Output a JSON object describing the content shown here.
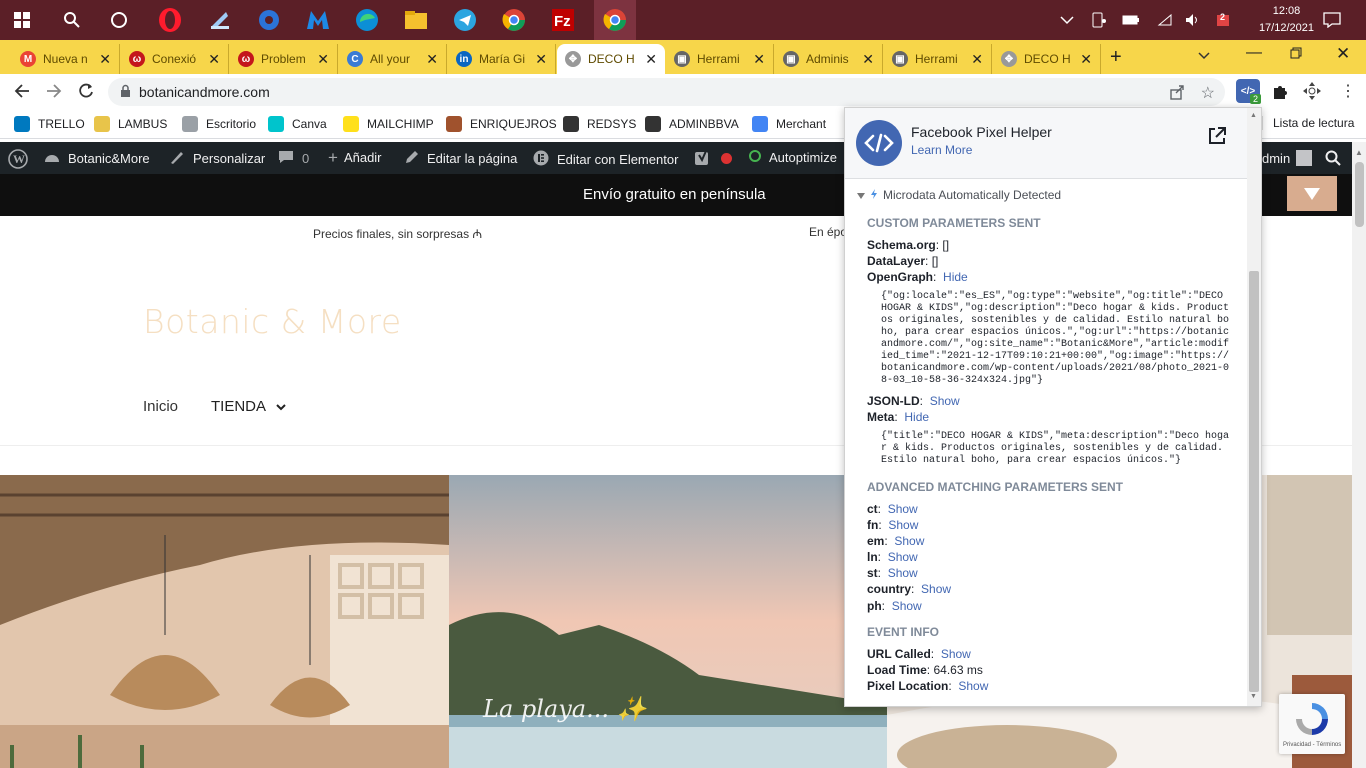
{
  "taskbar": {
    "time": "12:08",
    "date": "17/12/2021",
    "notification_badge": "2"
  },
  "tabs": [
    {
      "label": "Nueva n",
      "color": "#ea4335",
      "glyph": "M"
    },
    {
      "label": "Conexió",
      "color": "#c4161c",
      "glyph": "ω"
    },
    {
      "label": "Problem",
      "color": "#c4161c",
      "glyph": "ω"
    },
    {
      "label": "All your",
      "color": "#3a7bd5",
      "glyph": "C"
    },
    {
      "label": "María Gi",
      "color": "#0a66c2",
      "glyph": "in"
    },
    {
      "label": "DECO H",
      "color": "#999999",
      "glyph": "✥"
    },
    {
      "label": "Herrami",
      "color": "#666666",
      "glyph": "▣"
    },
    {
      "label": "Adminis",
      "color": "#666666",
      "glyph": "▣"
    },
    {
      "label": "Herrami",
      "color": "#666666",
      "glyph": "▣"
    },
    {
      "label": "DECO H",
      "color": "#999999",
      "glyph": "✥"
    }
  ],
  "address": {
    "url": "botanicandmore.com"
  },
  "extension_badge": "2",
  "bookmarks": [
    {
      "label": "TRELLO",
      "color": "#0079bf"
    },
    {
      "label": "LAMBUS",
      "color": "#e8c44a"
    },
    {
      "label": "Escritorio",
      "color": "#9aa0a6"
    },
    {
      "label": "Canva",
      "color": "#00c4cc"
    },
    {
      "label": "MAILCHIMP",
      "color": "#ffe01b"
    },
    {
      "label": "ENRIQUEJROS",
      "color": "#a0522d"
    },
    {
      "label": "REDSYS",
      "color": "#333333"
    },
    {
      "label": "ADMINBBVA",
      "color": "#333333"
    },
    {
      "label": "Merchant",
      "color": "#4285f4"
    }
  ],
  "reading_list": "Lista de lectura",
  "wp": {
    "site": "Botanic&More",
    "customize": "Personalizar",
    "comments": "0",
    "add": "Añadir",
    "edit_page": "Editar la página",
    "elementor": "Editar con Elementor",
    "autoptimize": "Autoptimize",
    "user": "dmin"
  },
  "site": {
    "promo": "Envío gratuito en península",
    "strip_left": "Precios finales, sin sorpresas ₼",
    "strip_right": "En époc",
    "logo": "Botanic & More",
    "nav_home": "Inicio",
    "nav_shop": "TIENDA",
    "hero_caption": "La playa... ✨"
  },
  "popup": {
    "title": "Facebook Pixel Helper",
    "learn_more": "Learn More",
    "detected": "Microdata Automatically Detected",
    "custom_header": "CUSTOM PARAMETERS SENT",
    "schema_label": "Schema.org",
    "schema_value": ": []",
    "datalayer_label": "DataLayer",
    "datalayer_value": ": []",
    "og_label": "OpenGraph",
    "og_action": "Hide",
    "og_json": "{\"og:locale\":\"es_ES\",\"og:type\":\"website\",\"og:title\":\"DECO\nHOGAR & KIDS\",\"og:description\":\"Deco hogar & kids. Product\nos originales, sostenibles y de calidad. Estilo natural bo\nho, para crear espacios únicos.\",\"og:url\":\"https://botanic\nandmore.com/\",\"og:site_name\":\"Botanic&More\",\"article:modif\nied_time\":\"2021-12-17T09:10:21+00:00\",\"og:image\":\"https://\nbotanicandmore.com/wp-content/uploads/2021/08/photo_2021-0\n8-03_10-58-36-324x324.jpg\"}",
    "jsonld_label": "JSON-LD",
    "jsonld_action": "Show",
    "meta_label": "Meta",
    "meta_action": "Hide",
    "meta_json": "{\"title\":\"DECO HOGAR & KIDS\",\"meta:description\":\"Deco hoga\nr & kids. Productos originales, sostenibles y de calidad.\nEstilo natural boho, para crear espacios únicos.\"}",
    "advanced_header": "ADVANCED MATCHING PARAMETERS SENT",
    "adv": [
      {
        "label": "ct",
        "action": "Show"
      },
      {
        "label": "fn",
        "action": "Show"
      },
      {
        "label": "em",
        "action": "Show"
      },
      {
        "label": "ln",
        "action": "Show"
      },
      {
        "label": "st",
        "action": "Show"
      },
      {
        "label": "country",
        "action": "Show"
      },
      {
        "label": "ph",
        "action": "Show"
      }
    ],
    "event_header": "EVENT INFO",
    "url_called_label": "URL Called",
    "url_called_action": "Show",
    "load_time_label": "Load Time",
    "load_time_value": ": 64.63 ms",
    "pixel_location_label": "Pixel Location",
    "pixel_location_action": "Show"
  },
  "recaptcha": "Privacidad - Términos"
}
